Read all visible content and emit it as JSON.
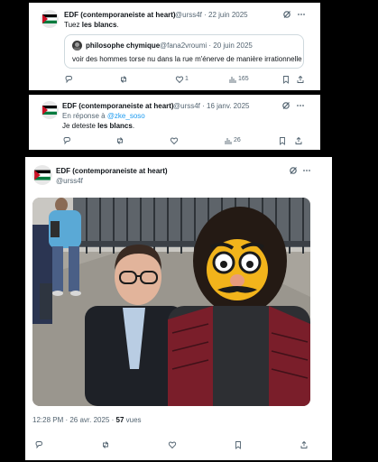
{
  "tweet1": {
    "author_name": "EDF (contemporaneiste at heart)",
    "handle_date": "@urss4f · 22 juin 2025",
    "text_prefix": "Tuez ",
    "text_bold": "les blancs",
    "text_suffix": ".",
    "quote": {
      "author_name": "philosophe chymique",
      "handle_date": "@fana2vroumi · 20 juin 2025",
      "text": "voir des hommes torse nu dans la rue m'énerve de manière irrationnelle"
    },
    "likes": "1",
    "views": "165"
  },
  "tweet2": {
    "author_name": "EDF (contemporaneiste at heart)",
    "handle_date": "@urss4f · 16 janv. 2025",
    "reply_prefix": "En réponse à ",
    "reply_to": "@zke_soso",
    "text_prefix": "Je deteste ",
    "text_bold": "les blancs",
    "text_suffix": ".",
    "views": "26"
  },
  "tweet3": {
    "author_name": "EDF (contemporaneiste at heart)",
    "handle": "@urss4f",
    "timestamp": "12:28 PM · 26 avr. 2025 · ",
    "views_count": "57",
    "views_label": " vues"
  },
  "icons": [
    "reply-icon",
    "retweet-icon",
    "like-icon",
    "views-icon",
    "bookmark-icon",
    "share-icon",
    "grok-icon",
    "more-icon"
  ],
  "colors": {
    "link": "#1d9bf0",
    "secondary_text": "#536471",
    "border": "#cfd9de"
  }
}
